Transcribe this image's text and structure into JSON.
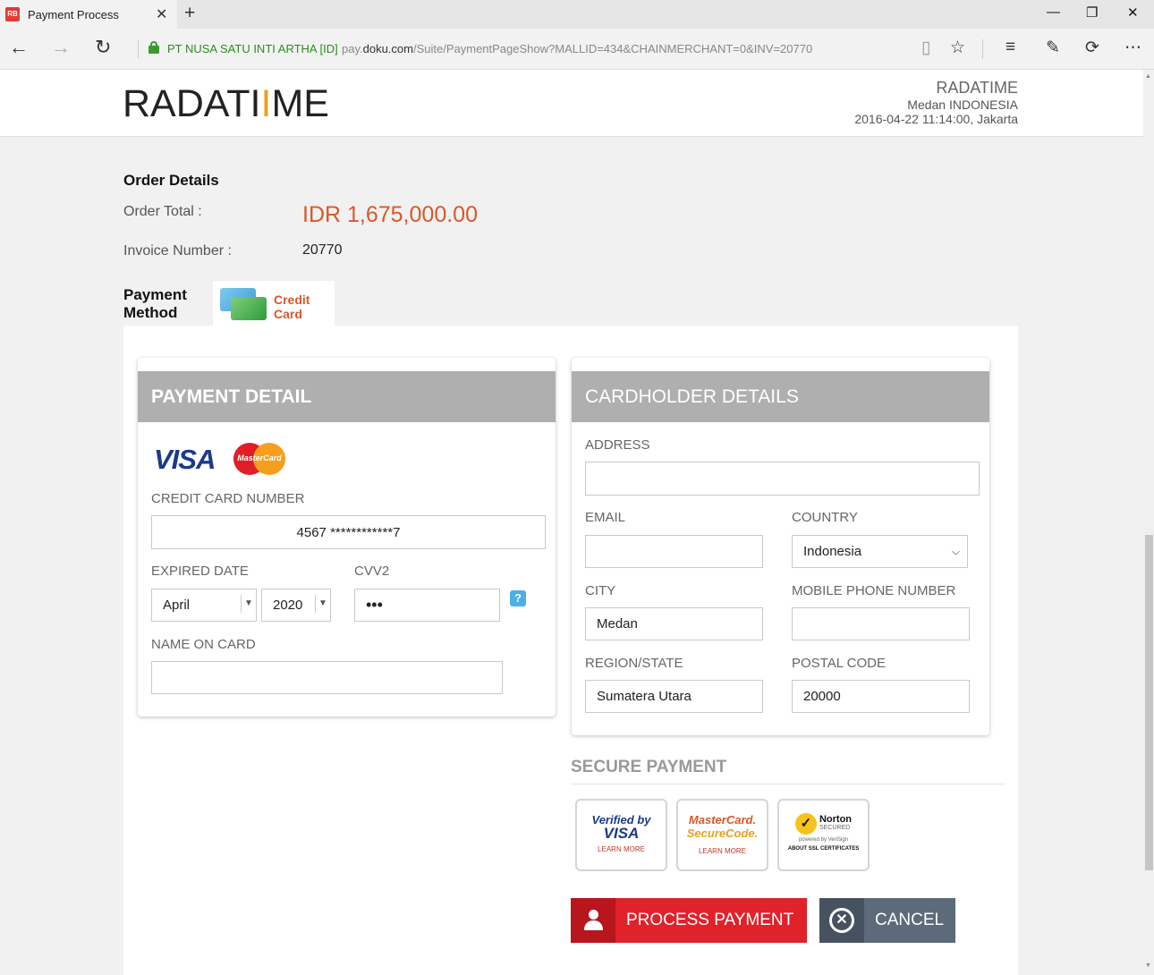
{
  "browser": {
    "tab_title": "Payment Process",
    "favicon_text": "RB",
    "new_tab_symbol": "+",
    "site_identity": "PT NUSA SATU INTI ARTHA [ID]",
    "url_domain_prefix": "pay.",
    "url_domain": "doku.com",
    "url_path": "/Suite/PaymentPageShow?MALLID=434&CHAINMERCHANT=0&INV=20770"
  },
  "header": {
    "logo_part1": "RADATI",
    "logo_accent": "I",
    "logo_part2": "ME",
    "merchant_name": "RADATIME",
    "merchant_location": "Medan INDONESIA",
    "merchant_datetime": "2016-04-22 11:14:00, Jakarta"
  },
  "order": {
    "title": "Order Details",
    "total_label": "Order Total :",
    "total_value": "IDR 1,675,000.00",
    "invoice_label": "Invoice Number :",
    "invoice_value": "20770"
  },
  "payment_method": {
    "label_line1": "Payment",
    "label_line2": "Method",
    "tab_line1": "Credit",
    "tab_line2": "Card"
  },
  "payment_detail": {
    "title": "PAYMENT DETAIL",
    "visa_text": "VISA",
    "mastercard_text": "MasterCard",
    "card_number_label": "CREDIT CARD NUMBER",
    "card_number_value": "4567 ************7",
    "expired_label": "EXPIRED DATE",
    "month_value": "April",
    "year_value": "2020",
    "cvv_label": "CVV2",
    "cvv_value": "•••",
    "help_symbol": "?",
    "name_label": "NAME ON CARD",
    "name_value": ""
  },
  "cardholder": {
    "title": "CARDHOLDER DETAILS",
    "address_label": "ADDRESS",
    "address_value": "",
    "email_label": "EMAIL",
    "email_value": "",
    "country_label": "COUNTRY",
    "country_value": "Indonesia",
    "city_label": "CITY",
    "city_value": "Medan",
    "mobile_label": "MOBILE PHONE NUMBER",
    "mobile_value": "",
    "region_label": "REGION/STATE",
    "region_value": "Sumatera Utara",
    "postal_label": "POSTAL CODE",
    "postal_value": "20000"
  },
  "secure": {
    "title": "SECURE PAYMENT",
    "verified_line1": "Verified by",
    "verified_line2": "VISA",
    "verified_link": "LEARN MORE",
    "mc_line1": "MasterCard.",
    "mc_line2": "SecureCode.",
    "mc_link": "LEARN MORE",
    "norton_name": "Norton",
    "norton_secured": "SECURED",
    "norton_powered": "powered by VeriSign",
    "norton_link": "ABOUT SSL CERTIFICATES"
  },
  "actions": {
    "process_label": "PROCESS PAYMENT",
    "cancel_label": "CANCEL"
  },
  "colors": {
    "accent_orange": "#d9582a",
    "process_red": "#e0222b",
    "cancel_slate": "#5c6a7a",
    "panel_header_gray": "#afafaf"
  }
}
